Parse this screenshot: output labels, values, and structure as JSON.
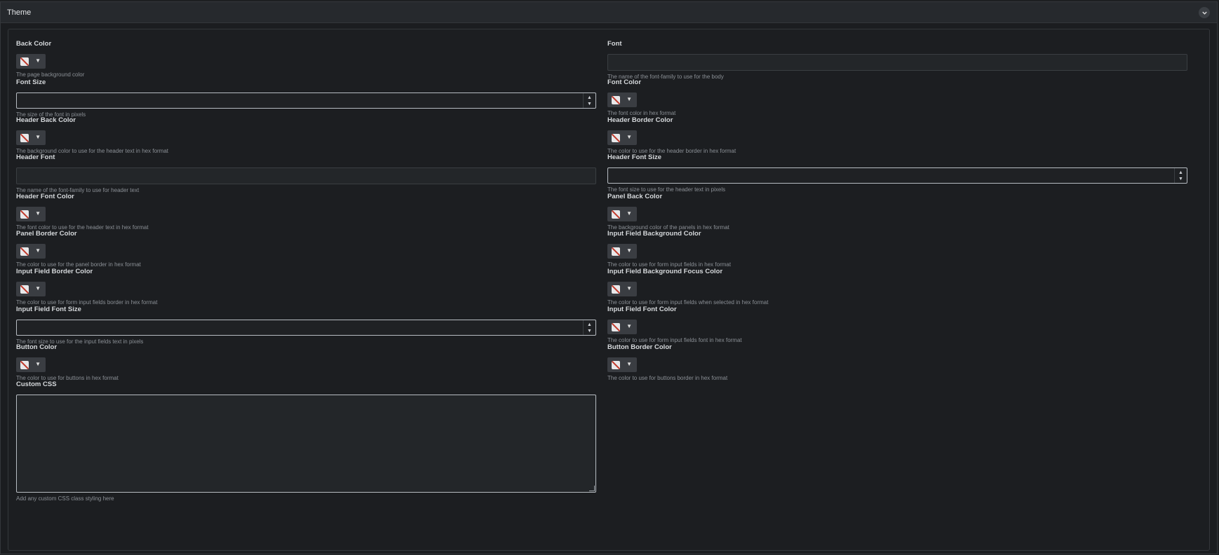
{
  "section": {
    "title": "Theme"
  },
  "fields": {
    "back_color": {
      "label": "Back Color",
      "help": "The page background color"
    },
    "font": {
      "label": "Font",
      "help": "The name of the font-family to use for the body"
    },
    "font_size": {
      "label": "Font Size",
      "help": "The size of the font in pixels"
    },
    "font_color": {
      "label": "Font Color",
      "help": "The font color in hex format"
    },
    "header_back_color": {
      "label": "Header Back Color",
      "help": "The background color to use for the header text in hex format"
    },
    "header_border_color": {
      "label": "Header Border Color",
      "help": "The color to use for the header border in hex format"
    },
    "header_font": {
      "label": "Header Font",
      "help": "The name of the font-family to use for header text"
    },
    "header_font_size": {
      "label": "Header Font Size",
      "help": "The font size to use for the header text in pixels"
    },
    "header_font_color": {
      "label": "Header Font Color",
      "help": "The font color to use for the header text in hex format"
    },
    "panel_back_color": {
      "label": "Panel Back Color",
      "help": "The background color of the panels in hex format"
    },
    "panel_border_color": {
      "label": "Panel Border Color",
      "help": "The color to use for the panel border in hex format"
    },
    "input_bg_color": {
      "label": "Input Field Background Color",
      "help": "The color to use for form input fields in hex format"
    },
    "input_border_color": {
      "label": "Input Field Border Color",
      "help": "The color to use for form input fields border in hex format"
    },
    "input_bg_focus_color": {
      "label": "Input Field Background Focus Color",
      "help": "The color to use for form input fields when selected in hex format"
    },
    "input_font_size": {
      "label": "Input Field Font Size",
      "help": "The font size to use for the input fields text in pixels"
    },
    "input_font_color": {
      "label": "Input Field Font Color",
      "help": "The color to use for form input fields font in hex format"
    },
    "button_color": {
      "label": "Button Color",
      "help": "The color to use for buttons in hex format"
    },
    "button_border_color": {
      "label": "Button Border Color",
      "help": "The color to use for buttons border in hex format"
    },
    "custom_css": {
      "label": "Custom CSS",
      "help": "Add any custom CSS class styling here"
    }
  },
  "icons": {
    "collapse": "chevron-down-icon",
    "swatch": "empty-color-swatch-icon",
    "caret": "caret-down-icon"
  },
  "colors": {
    "page_bg": "#1d1f21",
    "panel_border": "#34373b",
    "input_bg": "#232629",
    "picker_bg": "#3a3d42"
  }
}
